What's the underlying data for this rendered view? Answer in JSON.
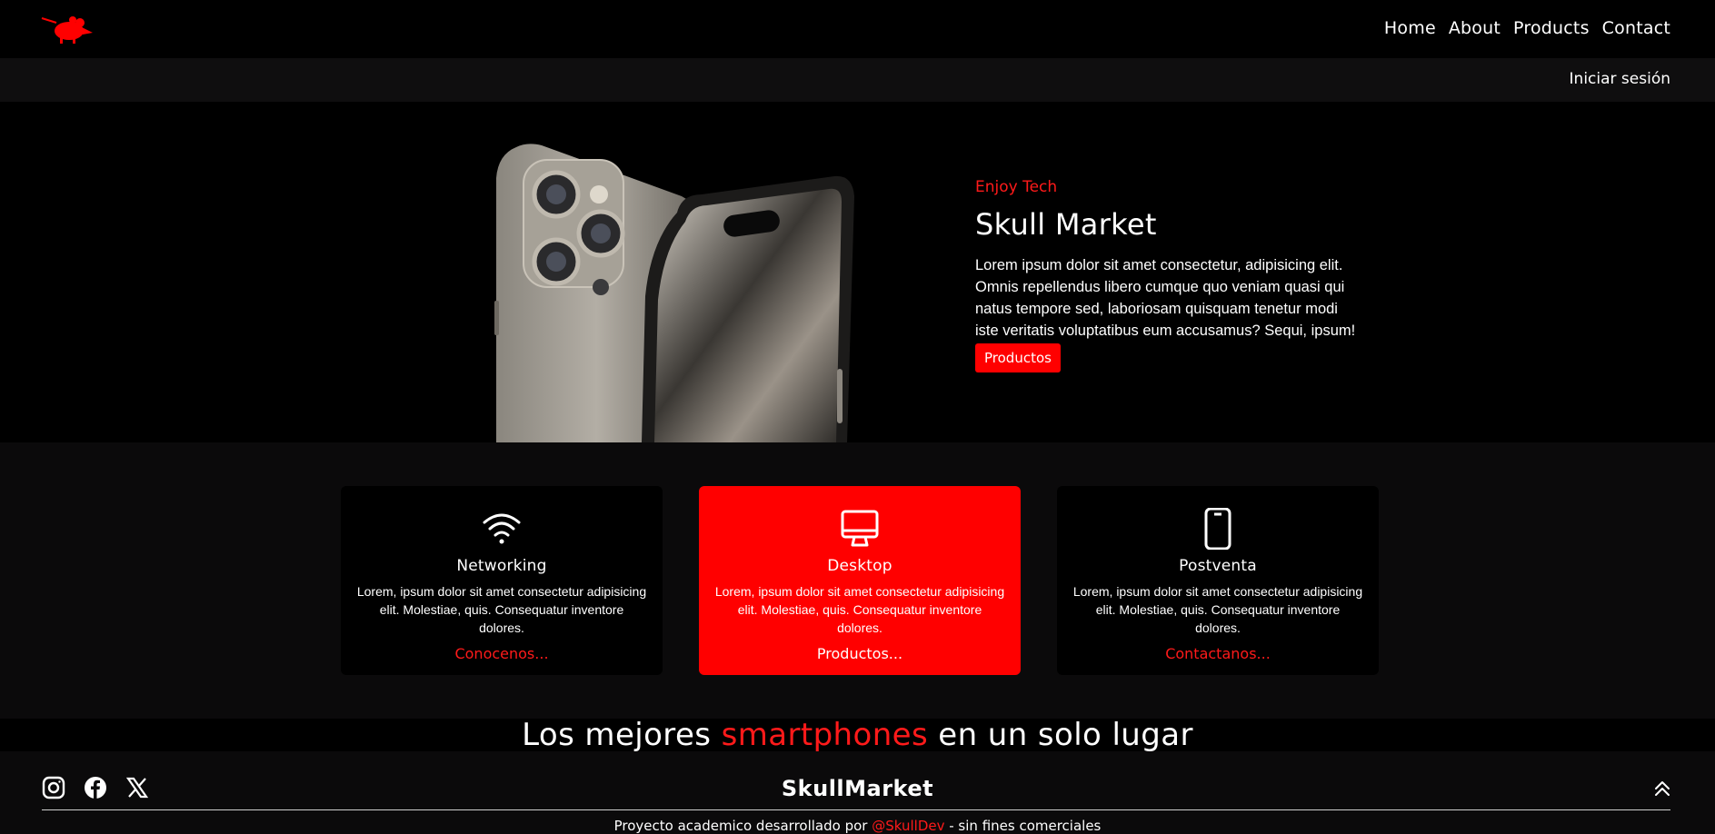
{
  "nav": {
    "links": [
      "Home",
      "About",
      "Products",
      "Contact"
    ],
    "login": "Iniciar sesión"
  },
  "hero": {
    "eyebrow": "Enjoy Tech",
    "title": "Skull Market",
    "description": "Lorem ipsum dolor sit amet consectetur, adipisicing elit. Omnis repellendus libero cumque quo veniam quasi qui natus tempore sed, laboriosam quisquam tenetur modi iste veritatis voluptatibus eum accusamus? Sequi, ipsum!",
    "button": "Productos"
  },
  "cards": [
    {
      "icon": "wifi-icon",
      "title": "Networking",
      "text": "Lorem, ipsum dolor sit amet consectetur adipisicing elit. Molestiae, quis. Consequatur inventore dolores.",
      "link": "Conocenos..."
    },
    {
      "icon": "desktop-icon",
      "title": "Desktop",
      "text": "Lorem, ipsum dolor sit amet consectetur adipisicing elit. Molestiae, quis. Consequatur inventore dolores.",
      "link": "Productos..."
    },
    {
      "icon": "smartphone-icon",
      "title": "Postventa",
      "text": "Lorem, ipsum dolor sit amet consectetur adipisicing elit. Molestiae, quis. Consequatur inventore dolores.",
      "link": "Contactanos..."
    }
  ],
  "tagline": {
    "before": "Los mejores ",
    "accent": "smartphones",
    "after": " en un solo lugar"
  },
  "footer": {
    "brand": "SkullMarket",
    "credit_before": "Proyecto academico desarrollado por ",
    "credit_handle": "@SkullDev",
    "credit_after": " - sin fines comerciales"
  },
  "colors": {
    "accent": "#ff0000",
    "background": "#000000",
    "surface": "#0b0a0b"
  }
}
